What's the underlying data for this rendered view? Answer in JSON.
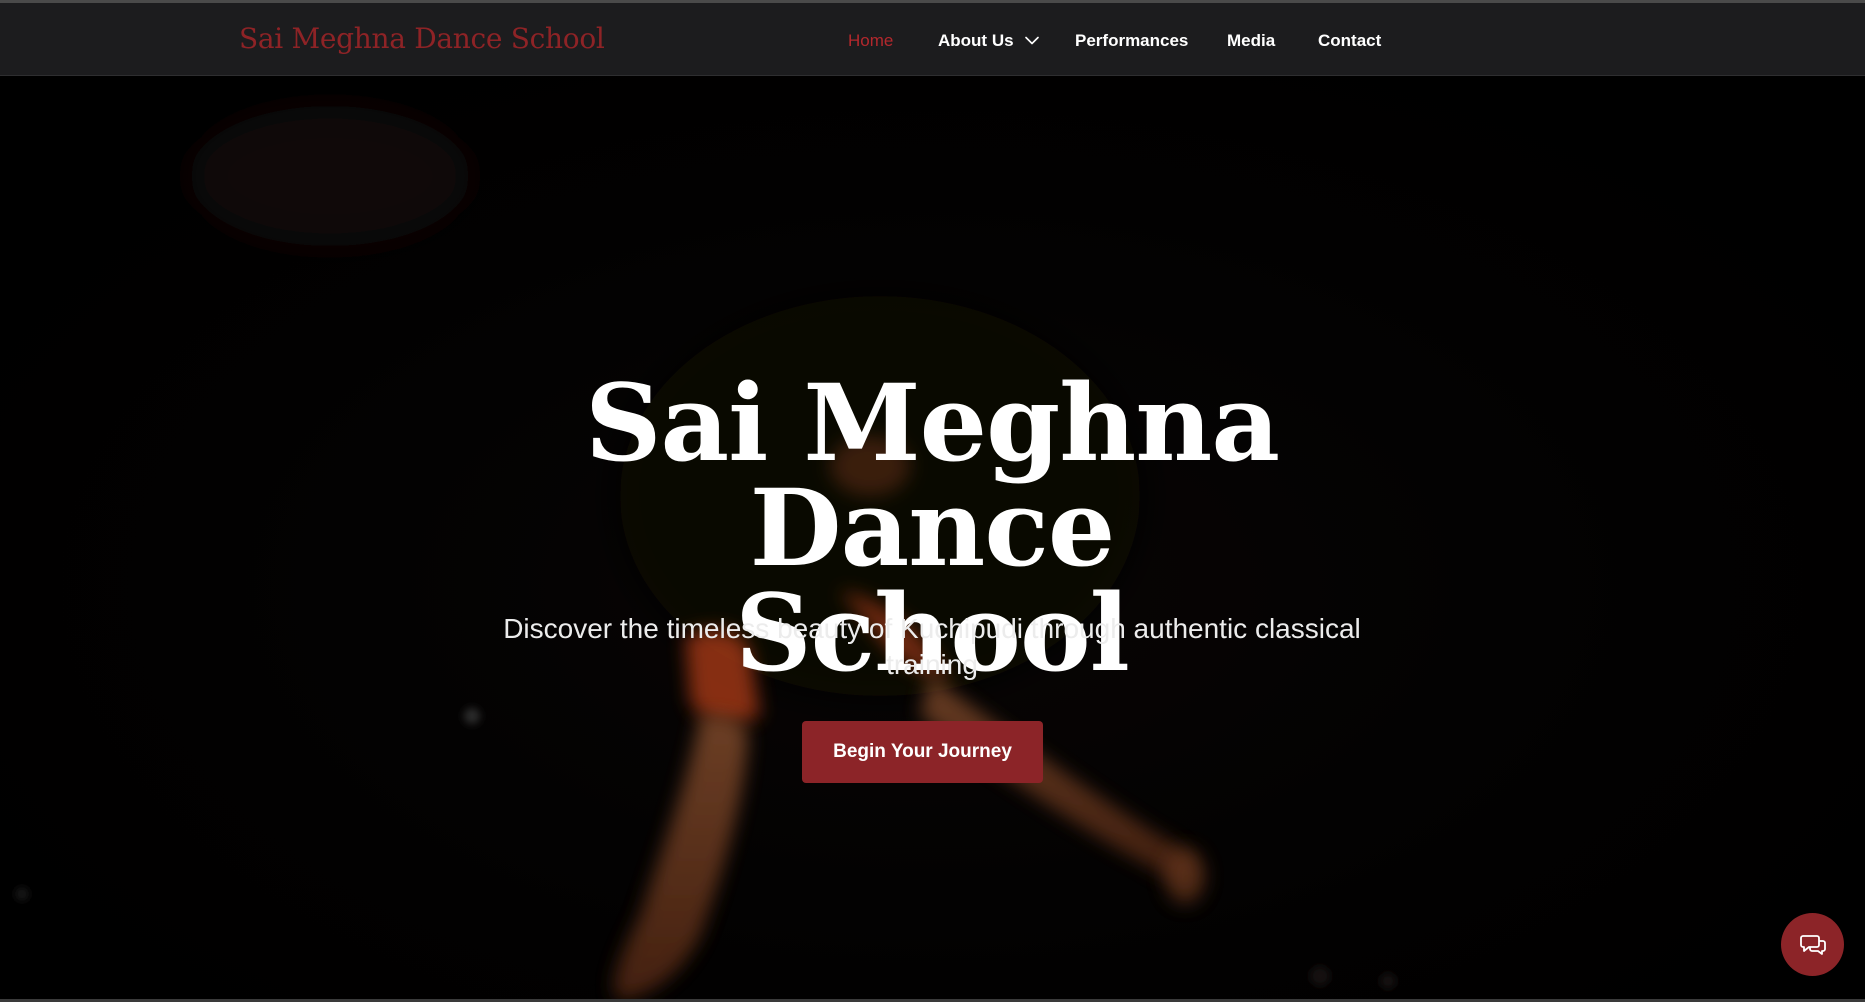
{
  "nav": {
    "brand": "Sai Meghna Dance School",
    "items": [
      {
        "label": "Home",
        "active": true
      },
      {
        "label": "About Us",
        "has_dropdown": true
      },
      {
        "label": "Performances"
      },
      {
        "label": "Media"
      },
      {
        "label": "Contact"
      }
    ]
  },
  "hero": {
    "title_line1": "Sai Meghna Dance",
    "title_line2": "School",
    "subtitle_line1": "Discover the timeless beauty of Kuchipudi through authentic classical",
    "subtitle_line2": "training",
    "cta_label": "Begin Your Journey"
  },
  "icons": {
    "dropdown": "chevron-down-icon",
    "chat": "chat-bubbles-icon"
  },
  "colors": {
    "accent": "#8c2428",
    "active_nav": "#b3282d",
    "navbar_bg": "#1c1c1e",
    "hero_bg": "#000000",
    "text": "#ffffff"
  }
}
